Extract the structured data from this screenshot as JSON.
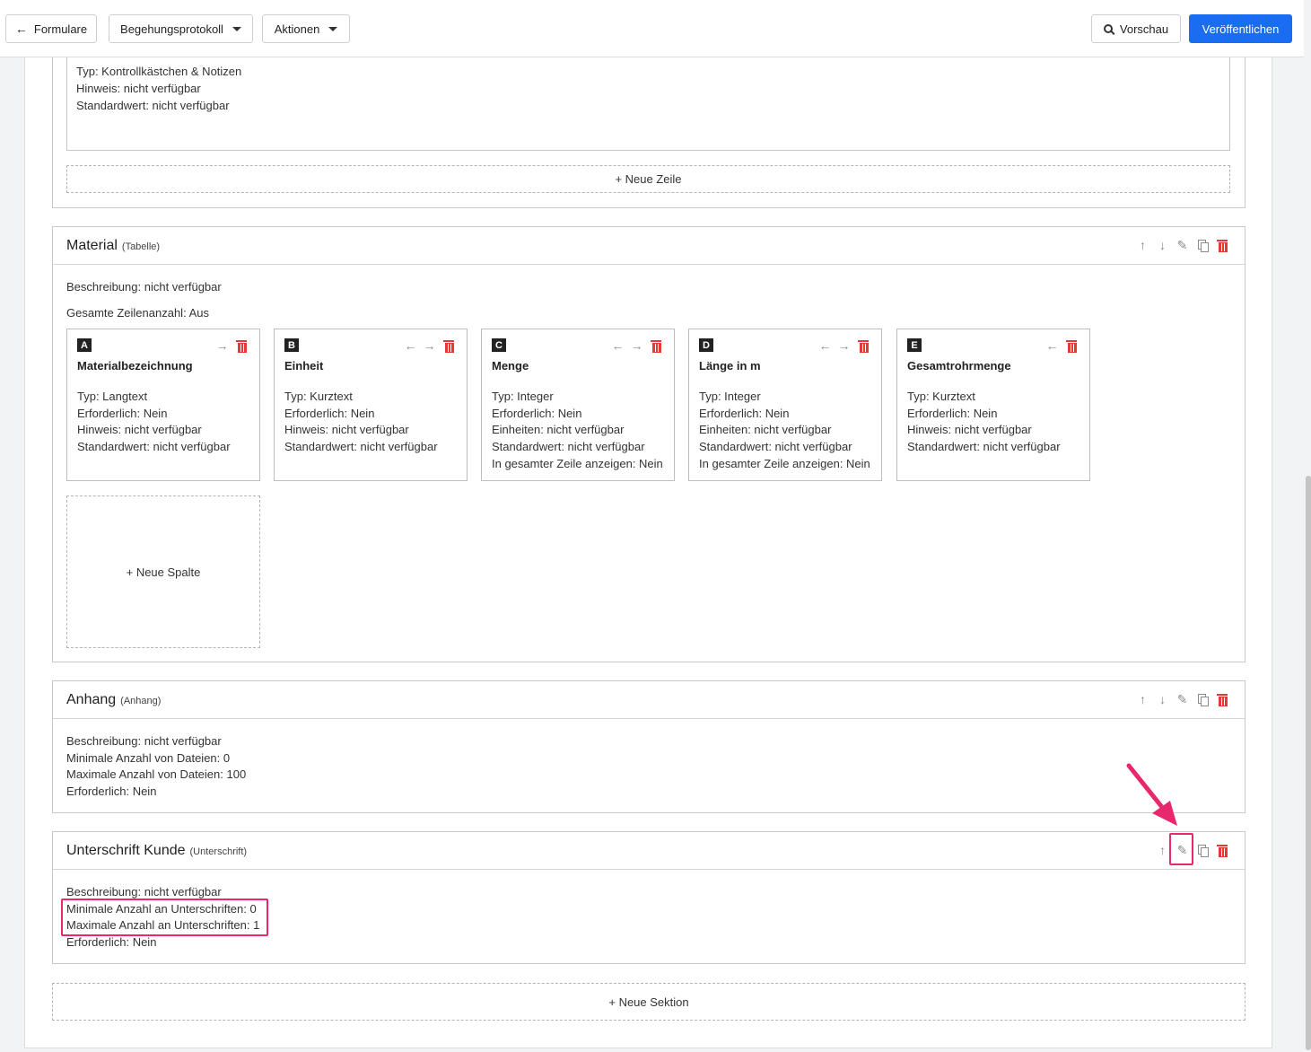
{
  "toolbar": {
    "back_label": "Formulare",
    "form_select": "Begehungsprotokoll",
    "actions_label": "Aktionen",
    "preview_label": "Vorschau",
    "publish_label": "Veröffentlichen"
  },
  "top_section": {
    "lines": [
      "Typ: Kontrollkästchen & Notizen",
      "Hinweis: nicht verfügbar",
      "Standardwert: nicht verfügbar"
    ],
    "add_row_label": "+ Neue Zeile"
  },
  "material": {
    "title": "Material",
    "type": "(Tabelle)",
    "description": "Beschreibung: nicht verfügbar",
    "total_rows": "Gesamte Zeilenanzahl: Aus",
    "columns": [
      {
        "letter": "A",
        "name": "Materialbezeichnung",
        "lines": [
          "Typ: Langtext",
          "Erforderlich: Nein",
          "Hinweis: nicht verfügbar",
          "Standardwert: nicht verfügbar"
        ]
      },
      {
        "letter": "B",
        "name": "Einheit",
        "lines": [
          "Typ: Kurztext",
          "Erforderlich: Nein",
          "Hinweis: nicht verfügbar",
          "Standardwert: nicht verfügbar"
        ]
      },
      {
        "letter": "C",
        "name": "Menge",
        "lines": [
          "Typ: Integer",
          "Erforderlich: Nein",
          "Einheiten: nicht verfügbar",
          "Standardwert: nicht verfügbar",
          "In gesamter Zeile anzeigen: Nein"
        ]
      },
      {
        "letter": "D",
        "name": "Länge in m",
        "lines": [
          "Typ: Integer",
          "Erforderlich: Nein",
          "Einheiten: nicht verfügbar",
          "Standardwert: nicht verfügbar",
          "In gesamter Zeile anzeigen: Nein"
        ]
      },
      {
        "letter": "E",
        "name": "Gesamtrohrmenge",
        "lines": [
          "Typ: Kurztext",
          "Erforderlich: Nein",
          "Hinweis: nicht verfügbar",
          "Standardwert: nicht verfügbar"
        ]
      }
    ],
    "add_column_label": "+ Neue Spalte"
  },
  "anhang": {
    "title": "Anhang",
    "type": "(Anhang)",
    "lines": [
      "Beschreibung: nicht verfügbar",
      "Minimale Anzahl von Dateien: 0",
      "Maximale Anzahl von Dateien: 100",
      "Erforderlich: Nein"
    ]
  },
  "unterschrift": {
    "title": "Unterschrift Kunde",
    "type": "(Unterschrift)",
    "lines": [
      "Beschreibung: nicht verfügbar",
      "Minimale Anzahl an Unterschriften: 0",
      "Maximale Anzahl an Unterschriften: 1",
      "Erforderlich: Nein"
    ]
  },
  "add_section_label": "+ Neue Sektion",
  "icons": {
    "up": "arrow-up-icon",
    "down": "arrow-down-icon",
    "edit": "pencil-icon",
    "copy": "copy-icon",
    "delete": "trash-icon",
    "left": "arrow-left-icon",
    "right": "arrow-right-icon"
  },
  "colors": {
    "primary": "#1a6cf0",
    "danger": "#e53935",
    "highlight": "#e8286d"
  }
}
